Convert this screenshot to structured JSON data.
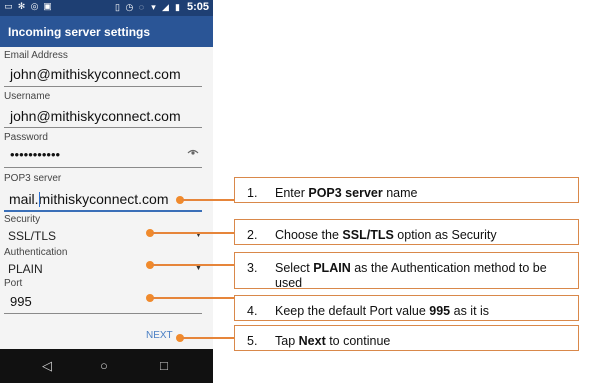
{
  "status_bar": {
    "time": "5:05"
  },
  "app_bar": {
    "title": "Incoming server settings"
  },
  "fields": {
    "email": {
      "label": "Email Address",
      "value": "john@mithiskyconnect.com"
    },
    "username": {
      "label": "Username",
      "value": "john@mithiskyconnect.com"
    },
    "password": {
      "label": "Password",
      "value": "•••••••••••"
    },
    "pop3_server": {
      "label": "POP3 server",
      "value": "mail.mithiskyconnect.com"
    },
    "security": {
      "label": "Security",
      "value": "SSL/TLS"
    },
    "authentication": {
      "label": "Authentication",
      "value": "PLAIN"
    },
    "port": {
      "label": "Port",
      "value": "995"
    }
  },
  "next_button": {
    "label": "NEXT"
  },
  "callouts": [
    {
      "number": "1.",
      "pre": "Enter ",
      "bold": "POP3 server",
      "post": " name"
    },
    {
      "number": "2.",
      "pre": "Choose the ",
      "bold": "SSL/TLS",
      "post": " option as Security"
    },
    {
      "number": "3.",
      "pre": "Select ",
      "bold": "PLAIN",
      "post": " as the Authentication method to be used"
    },
    {
      "number": "4.",
      "pre": "Keep the default Port value ",
      "bold": "995",
      "post": " as it is"
    },
    {
      "number": "5.",
      "pre": "Tap ",
      "bold": "Next",
      "post": " to continue"
    }
  ],
  "colors": {
    "app_bar": "#2a5596",
    "status_bar": "#1e3f73",
    "accent": "#e6853a",
    "link": "#4a7fc4"
  }
}
